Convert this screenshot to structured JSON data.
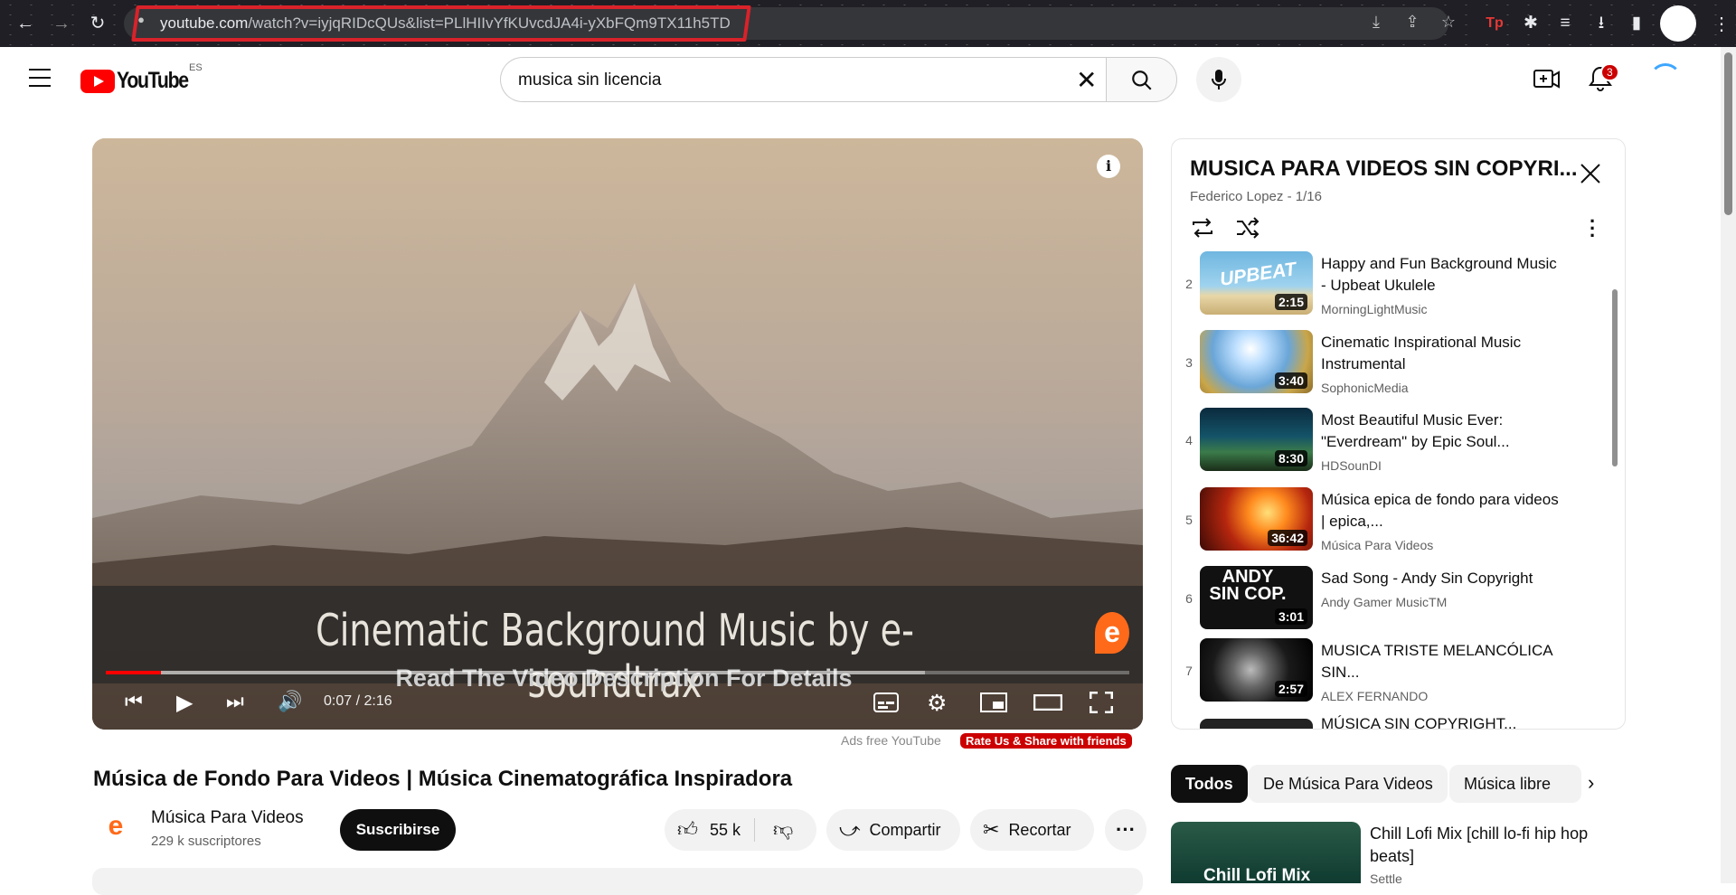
{
  "browser": {
    "url_host": "youtube.com",
    "url_rest": "/watch?v=iyjqRIDcQUs&list=PLlHIIvYfKUvcdJA4i-yXbFQm9TX11h5TD",
    "ext_tp": "Tp"
  },
  "header": {
    "logo_text": "YouTube",
    "country_code": "ES",
    "search_value": "musica sin licencia",
    "notifications_count": "3"
  },
  "player": {
    "banner_title": "Cinematic Background Music by e-soundtrax",
    "banner_subtitle": "Read The Video Description For Details",
    "time_display": "0:07 / 2:16",
    "progress_fraction": 0.054,
    "info_label": "i",
    "brand_glyph": "e"
  },
  "below_player": {
    "ads_free": "Ads free YouTube",
    "rate_share": "Rate Us & Share with friends"
  },
  "video": {
    "title": "Música de Fondo Para Videos | Música Cinematográfica Inspiradora",
    "channel_name": "Música Para Videos",
    "channel_subs": "229 k suscriptores",
    "channel_avatar_glyph": "e",
    "subscribe_label": "Suscribirse",
    "like_count": "55 k",
    "share_label": "Compartir",
    "clip_label": "Recortar"
  },
  "playlist": {
    "title": "MUSICA PARA VIDEOS SIN COPYRI...",
    "meta": "Federico Lopez - 1/16",
    "items": [
      {
        "index": "2",
        "title": "Happy and Fun Background Music - Upbeat Ukulele",
        "channel": "MorningLightMusic",
        "duration": "2:15"
      },
      {
        "index": "3",
        "title": "Cinematic Inspirational Music Instrumental",
        "channel": "SophonicMedia",
        "duration": "3:40"
      },
      {
        "index": "4",
        "title": "Most Beautiful Music Ever: \"Everdream\" by Epic Soul...",
        "channel": "HDSounDI",
        "duration": "8:30"
      },
      {
        "index": "5",
        "title": "Música epica de fondo para videos | epica,...",
        "channel": "Música Para Videos",
        "duration": "36:42"
      },
      {
        "index": "6",
        "title": "Sad Song - Andy Sin Copyright",
        "channel": "Andy Gamer MusicTM",
        "duration": "3:01"
      },
      {
        "index": "7",
        "title": "MUSICA TRISTE MELANCÓLICA SIN...",
        "channel": "ALEX FERNANDO",
        "duration": "2:57"
      },
      {
        "index": "",
        "title": "MÚSICA SIN COPYRIGHT...",
        "channel": "",
        "duration": ""
      }
    ],
    "thumb_text_upbeat": "UPBEAT",
    "thumb_text_andy": "ANDY SIN COP."
  },
  "chips": [
    "Todos",
    "De Música Para Videos",
    "Música libre"
  ],
  "recommendation": {
    "title": "Chill Lofi Mix [chill lo-fi hip hop beats]",
    "channel": "Settle",
    "thumb_text": "Chill Lofi Mix"
  },
  "colors": {
    "youtube_red": "#ff0000",
    "highlight_red": "#d9222a",
    "progress_red": "#ff0000"
  }
}
